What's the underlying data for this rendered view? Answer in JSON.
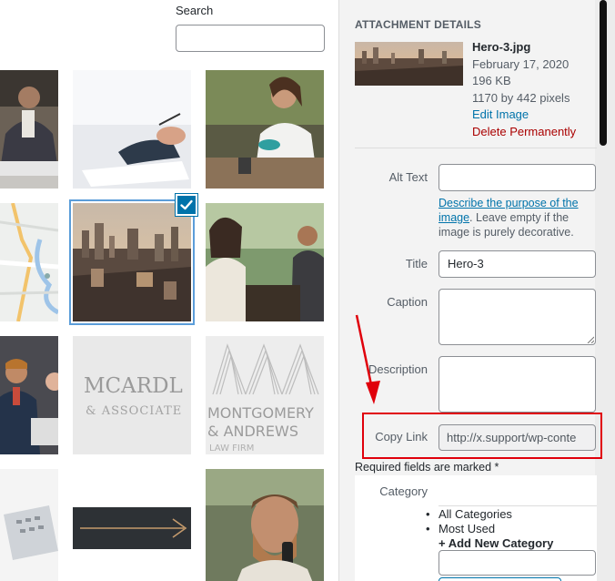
{
  "search": {
    "label": "Search",
    "placeholder": ""
  },
  "grid": {
    "tiles": [
      {
        "name": "tile-business-man"
      },
      {
        "name": "tile-hand-pen"
      },
      {
        "name": "tile-woman-cafe"
      },
      {
        "name": "tile-map"
      },
      {
        "name": "tile-hero-city",
        "selected": true
      },
      {
        "name": "tile-meeting-two"
      },
      {
        "name": "tile-office-group"
      },
      {
        "name": "tile-mcardle-logo",
        "text1": "MCARDL",
        "text2": "& ASSOCIATE"
      },
      {
        "name": "tile-montgomery-logo",
        "text1": "MONTGOMERY",
        "text2": "& ANDREWS",
        "text3": "LAW FIRM"
      },
      {
        "name": "tile-laptop"
      },
      {
        "name": "tile-arrow-banner"
      },
      {
        "name": "tile-bearded-man-phone"
      }
    ]
  },
  "details": {
    "heading": "Attachment Details",
    "filename": "Hero-3.jpg",
    "date": "February 17, 2020",
    "size": "196 KB",
    "dimensions": "1170 by 442 pixels",
    "edit_label": "Edit Image",
    "delete_label": "Delete Permanently"
  },
  "form": {
    "alt_label": "Alt Text",
    "alt_value": "",
    "help_link": "Describe the purpose of the image",
    "help_text": ". Leave empty if the image is purely decorative.",
    "title_label": "Title",
    "title_value": "Hero-3",
    "caption_label": "Caption",
    "description_label": "Description",
    "copy_label": "Copy Link",
    "copy_value": "http://x.support/wp-conte",
    "required_text": "Required fields are marked *",
    "category_label": "Category",
    "categories": [
      "All Categories",
      "Most Used"
    ],
    "add_category": "+ Add New Category"
  },
  "colors": {
    "link": "#0073aa",
    "delete": "#aa0000",
    "highlight": "#e0000b",
    "selected": "#0073aa"
  }
}
